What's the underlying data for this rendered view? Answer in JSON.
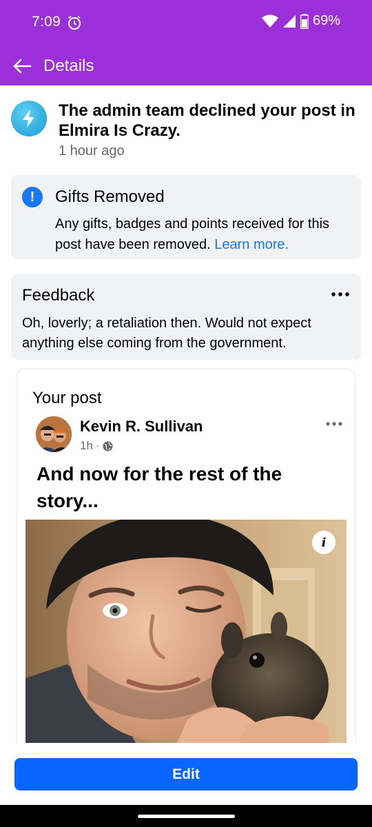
{
  "status_bar": {
    "time": "7:09",
    "battery": "69%",
    "icons": [
      "alarm-icon",
      "wifi-icon",
      "signal-icon",
      "battery-icon"
    ]
  },
  "app_bar": {
    "title": "Details",
    "back_icon": "arrow-left-icon",
    "background": "#9b30d9"
  },
  "notice": {
    "icon": "lightning-icon",
    "text": "The admin team declined your post in Elmira Is Crazy.",
    "time": "1 hour ago"
  },
  "gifts": {
    "icon": "exclamation-icon",
    "title": "Gifts Removed",
    "body": "Any gifts, badges and points received for this post have been removed.",
    "link": "Learn more."
  },
  "feedback": {
    "title": "Feedback",
    "body": "Oh, loverly; a retaliation then. Would not expect anything else coming from the government.",
    "more_icon": "more-horizontal-icon"
  },
  "post": {
    "label": "Your post",
    "author": "Kevin R. Sullivan",
    "time": "1h",
    "privacy_icon": "globe-icon",
    "headline": "And now for the rest of the story...",
    "info_icon": "info-icon"
  },
  "actions": {
    "edit_label": "Edit",
    "accent": "#0866ff"
  }
}
